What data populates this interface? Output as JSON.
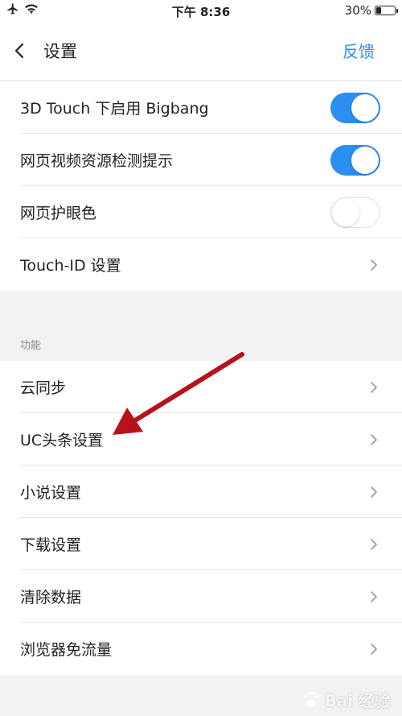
{
  "status_bar": {
    "time": "下午 8:36",
    "battery": "30%",
    "battery_level": 0.3
  },
  "nav": {
    "title": "设置",
    "feedback_label": "反馈"
  },
  "settings_group": {
    "rows": [
      {
        "label": "3D Touch 下启用 Bigbang",
        "control": "toggle",
        "on": true
      },
      {
        "label": "网页视频资源检测提示",
        "control": "toggle",
        "on": true
      },
      {
        "label": "网页护眼色",
        "control": "toggle",
        "on": false
      },
      {
        "label": "Touch-ID 设置",
        "control": "chevron"
      }
    ]
  },
  "features_section": {
    "header": "功能",
    "rows": [
      {
        "label": "云同步"
      },
      {
        "label": "UC头条设置"
      },
      {
        "label": "小说设置"
      },
      {
        "label": "下载设置"
      },
      {
        "label": "清除数据"
      },
      {
        "label": "浏览器免流量"
      }
    ]
  },
  "watermark": {
    "text": "Bai  经验"
  },
  "colors": {
    "accent": "#2b8ff2",
    "arrow": "#b5121b",
    "background": "#f2f2f4"
  },
  "icons": [
    "airplane-icon",
    "wifi-icon",
    "battery-icon",
    "back-chevron-icon",
    "chevron-right-icon",
    "baidu-paw-icon"
  ]
}
